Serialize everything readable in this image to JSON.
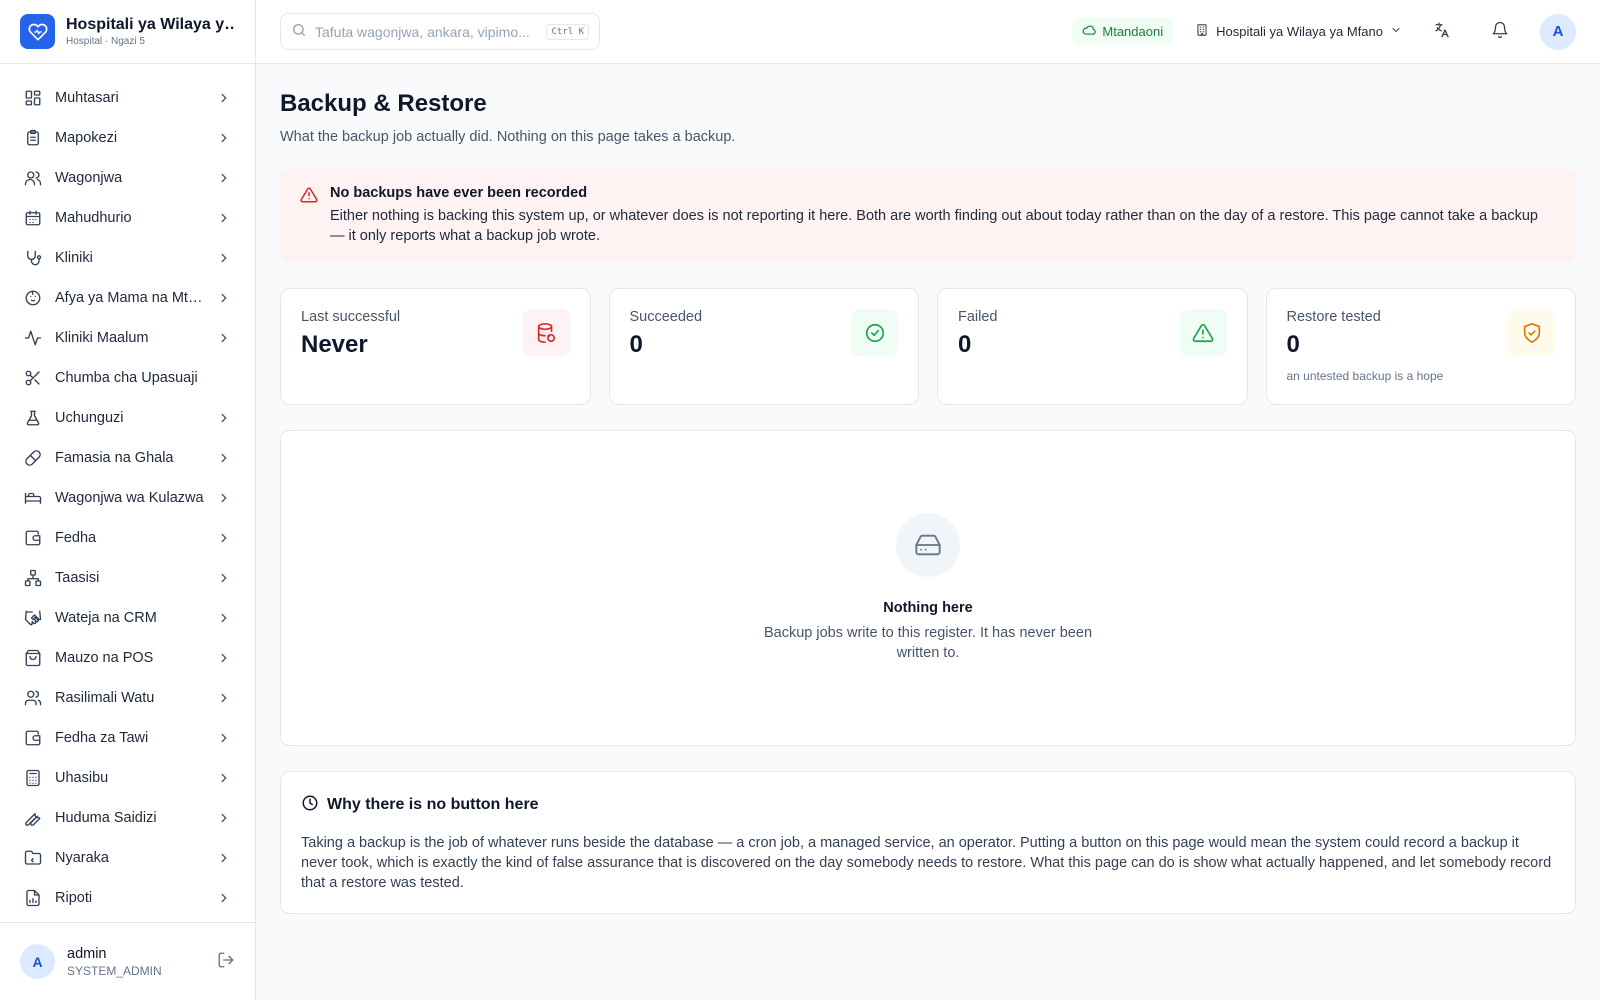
{
  "brand": {
    "title": "Hospitali ya Wilaya ya Mfano",
    "subtitle": "Hospital · Ngazi 5"
  },
  "nav": [
    {
      "label": "Muhtasari",
      "icon": "dashboard-icon",
      "chevron": true
    },
    {
      "label": "Mapokezi",
      "icon": "clipboard-icon",
      "chevron": true
    },
    {
      "label": "Wagonjwa",
      "icon": "users-icon",
      "chevron": true
    },
    {
      "label": "Mahudhurio",
      "icon": "calendar-icon",
      "chevron": true
    },
    {
      "label": "Kliniki",
      "icon": "stethoscope-icon",
      "chevron": true
    },
    {
      "label": "Afya ya Mama na Mtoto",
      "icon": "baby-icon",
      "chevron": true
    },
    {
      "label": "Kliniki Maalum",
      "icon": "activity-icon",
      "chevron": true
    },
    {
      "label": "Chumba cha Upasuaji",
      "icon": "scissors-icon",
      "chevron": false
    },
    {
      "label": "Uchunguzi",
      "icon": "flask-icon",
      "chevron": true
    },
    {
      "label": "Famasia na Ghala",
      "icon": "pill-icon",
      "chevron": true
    },
    {
      "label": "Wagonjwa wa Kulazwa",
      "icon": "bed-icon",
      "chevron": true
    },
    {
      "label": "Fedha",
      "icon": "wallet-icon",
      "chevron": true
    },
    {
      "label": "Taasisi",
      "icon": "network-icon",
      "chevron": true
    },
    {
      "label": "Wateja na CRM",
      "icon": "handshake-icon",
      "chevron": true
    },
    {
      "label": "Mauzo na POS",
      "icon": "shopping-bag-icon",
      "chevron": true
    },
    {
      "label": "Rasilimali Watu",
      "icon": "user-group-icon",
      "chevron": true
    },
    {
      "label": "Fedha za Tawi",
      "icon": "wallet-icon",
      "chevron": true
    },
    {
      "label": "Uhasibu",
      "icon": "calculator-icon",
      "chevron": true
    },
    {
      "label": "Huduma Saidizi",
      "icon": "wrench-icon",
      "chevron": true
    },
    {
      "label": "Nyaraka",
      "icon": "folder-icon",
      "chevron": true
    },
    {
      "label": "Ripoti",
      "icon": "report-icon",
      "chevron": true
    }
  ],
  "user": {
    "initial": "A",
    "name": "admin",
    "role": "SYSTEM_ADMIN"
  },
  "topbar": {
    "search_placeholder": "Tafuta wagonjwa, ankara, vipimo...",
    "shortcut": "Ctrl K",
    "status": "Mtandaoni",
    "facility": "Hospitali ya Wilaya ya Mfano",
    "avatar_initial": "A"
  },
  "page": {
    "title": "Backup & Restore",
    "subtitle": "What the backup job actually did. Nothing on this page takes a backup."
  },
  "alert": {
    "title": "No backups have ever been recorded",
    "body": "Either nothing is backing this system up, or whatever does is not reporting it here. Both are worth finding out about today rather than on the day of a restore. This page cannot take a backup — it only reports what a backup job wrote."
  },
  "stats": [
    {
      "label": "Last successful",
      "value": "Never",
      "note": "",
      "icon": "database-restore-icon",
      "color": "#dc2626",
      "bg": "#fef2f2"
    },
    {
      "label": "Succeeded",
      "value": "0",
      "note": "",
      "icon": "check-circle-icon",
      "color": "#16a34a",
      "bg": "#f0fdf4"
    },
    {
      "label": "Failed",
      "value": "0",
      "note": "",
      "icon": "warning-icon",
      "color": "#16a34a",
      "bg": "#f0fdf4"
    },
    {
      "label": "Restore tested",
      "value": "0",
      "note": "an untested backup is a hope",
      "icon": "shield-check-icon",
      "color": "#d97706",
      "bg": "#fffbeb"
    }
  ],
  "empty": {
    "title": "Nothing here",
    "body": "Backup jobs write to this register. It has never been written to."
  },
  "why": {
    "title": "Why there is no button here",
    "body": "Taking a backup is the job of whatever runs beside the database — a cron job, a managed service, an operator. Putting a button on this page would mean the system could record a backup it never took, which is exactly the kind of false assurance that is discovered on the day somebody needs to restore. What this page can do is show what actually happened, and let somebody record that a restore was tested."
  }
}
